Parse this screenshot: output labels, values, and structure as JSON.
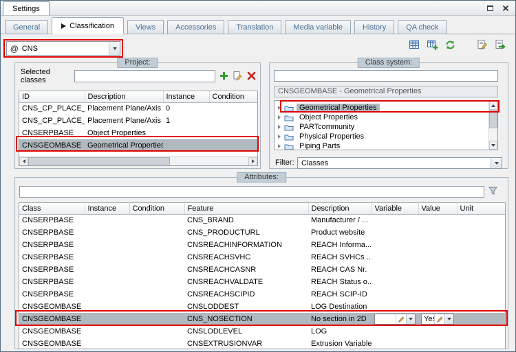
{
  "colors": {
    "selection": "#b1b9c0",
    "annotation": "#e10000",
    "tab_text": "#4a7090",
    "group_title_bg": "#c2cdd6"
  },
  "window": {
    "title": "Settings",
    "control_icons": [
      "maximize-icon",
      "close-icon"
    ]
  },
  "tabs": [
    {
      "label": "General"
    },
    {
      "label": "Classification",
      "active": true
    },
    {
      "label": "Views"
    },
    {
      "label": "Accessories"
    },
    {
      "label": "Translation"
    },
    {
      "label": "Media variable"
    },
    {
      "label": "History"
    },
    {
      "label": "QA check"
    }
  ],
  "context_combo": {
    "prefix": "@",
    "value": "CNS"
  },
  "toolbar": {
    "icons": [
      "grid-icon",
      "grid-add-icon",
      "refresh-icon",
      "page-edit-icon",
      "page-arrow-icon"
    ]
  },
  "project": {
    "header": "Project:",
    "selected_classes_label": "Selected classes",
    "selected_classes_value": "",
    "action_icons": [
      "add-icon",
      "edit-icon",
      "delete-icon"
    ],
    "columns": [
      "ID",
      "Description",
      "Instance",
      "Condition"
    ],
    "rows": [
      {
        "id": "CNS_CP_PLACE_PA",
        "description": "Placement Plane/Axis",
        "instance": "0",
        "condition": ""
      },
      {
        "id": "CNS_CP_PLACE_PA",
        "description": "Placement Plane/Axis",
        "instance": "1",
        "condition": ""
      },
      {
        "id": "CNSERPBASE",
        "description": "Object Properties",
        "instance": "",
        "condition": ""
      },
      {
        "id": "CNSGEOMBASE",
        "description": "Geometrical Properties",
        "instance": "",
        "condition": "",
        "selected": true
      }
    ]
  },
  "class_system": {
    "header": "Class system:",
    "search_value": "",
    "selected_class_caption": "CNSGEOMBASE - Geometrical Properties",
    "tree_items": [
      {
        "label": "Geometrical Properties",
        "selected": true
      },
      {
        "label": "Object Properties"
      },
      {
        "label": "PARTcommunity"
      },
      {
        "label": "Physical Properties"
      },
      {
        "label": "Piping Parts"
      }
    ],
    "filter_label": "Filter:",
    "filter_value": "Classes"
  },
  "attributes": {
    "header": "Attributes:",
    "filter_value": "",
    "columns": [
      "Class",
      "Instance",
      "Condition",
      "Feature",
      "Description",
      "Variable",
      "Value",
      "Unit"
    ],
    "rows": [
      {
        "class": "CNSERPBASE",
        "instance": "",
        "condition": "",
        "feature": "CNS_BRAND",
        "description": "Manufacturer / ...",
        "variable": "",
        "value": "",
        "unit": ""
      },
      {
        "class": "CNSERPBASE",
        "instance": "",
        "condition": "",
        "feature": "CNS_PRODUCTURL",
        "description": "Product website",
        "variable": "",
        "value": "",
        "unit": ""
      },
      {
        "class": "CNSERPBASE",
        "instance": "",
        "condition": "",
        "feature": "CNSREACHINFORMATION",
        "description": "REACH Informa...",
        "variable": "",
        "value": "",
        "unit": ""
      },
      {
        "class": "CNSERPBASE",
        "instance": "",
        "condition": "",
        "feature": "CNSREACHSVHC",
        "description": "REACH SVHCs ...",
        "variable": "",
        "value": "",
        "unit": ""
      },
      {
        "class": "CNSERPBASE",
        "instance": "",
        "condition": "",
        "feature": "CNSREACHCASNR",
        "description": "REACH CAS Nr.",
        "variable": "",
        "value": "",
        "unit": ""
      },
      {
        "class": "CNSERPBASE",
        "instance": "",
        "condition": "",
        "feature": "CNSREACHVALDATE",
        "description": "REACH Status o...",
        "variable": "",
        "value": "",
        "unit": ""
      },
      {
        "class": "CNSERPBASE",
        "instance": "",
        "condition": "",
        "feature": "CNSREACHSCIPID",
        "description": "REACH SCIP-ID",
        "variable": "",
        "value": "",
        "unit": ""
      },
      {
        "class": "CNSGEOMBASE",
        "instance": "",
        "condition": "",
        "feature": "CNSLODDEST",
        "description": "LOG Destination",
        "variable": "",
        "value": "",
        "unit": ""
      },
      {
        "class": "CNSGEOMBASE",
        "instance": "",
        "condition": "",
        "feature": "CNS_NOSECTION",
        "description": "No section in 2D",
        "variable": "",
        "value": "Yes",
        "unit": "",
        "selected": true
      },
      {
        "class": "CNSGEOMBASE",
        "instance": "",
        "condition": "",
        "feature": "CNSLODLEVEL",
        "description": "LOG",
        "variable": "",
        "value": "",
        "unit": ""
      },
      {
        "class": "CNSGEOMBASE",
        "instance": "",
        "condition": "",
        "feature": "CNSEXTRUSIONVAR",
        "description": "Extrusion Variable",
        "variable": "",
        "value": "",
        "unit": ""
      }
    ]
  }
}
